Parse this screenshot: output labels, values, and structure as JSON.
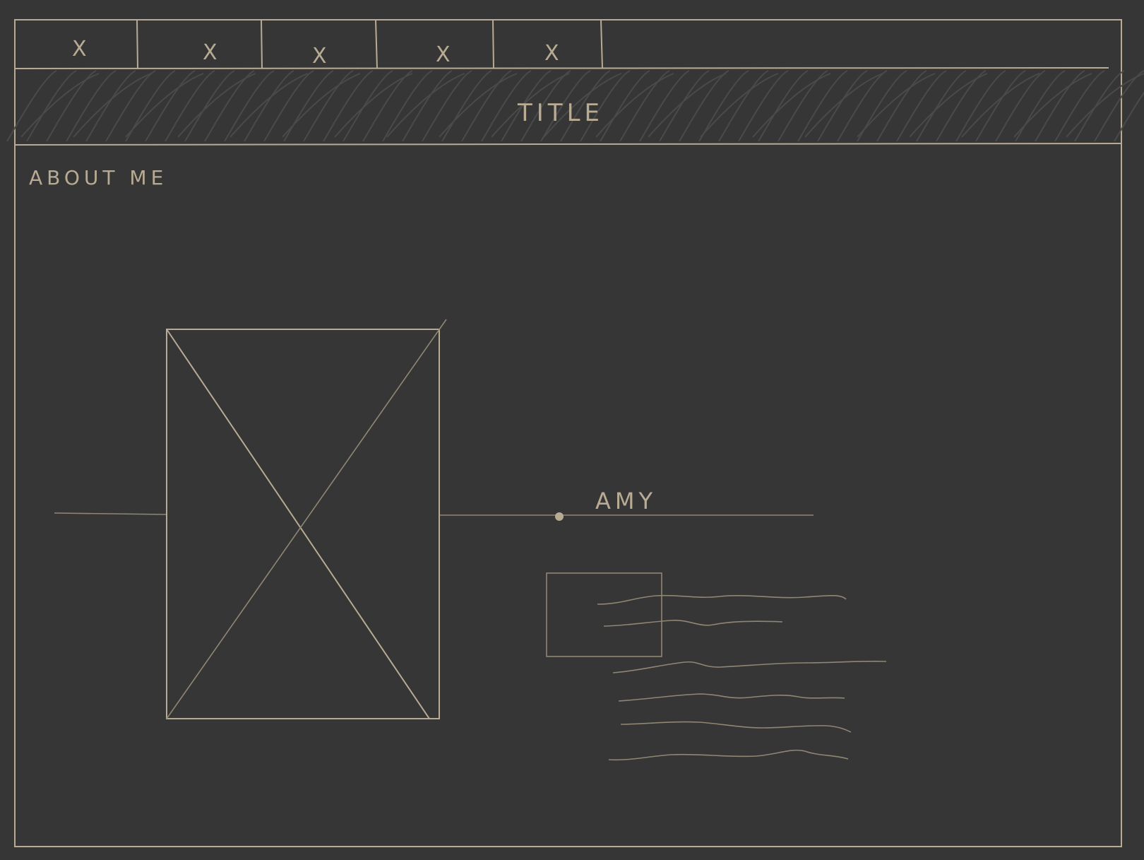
{
  "tabs": [
    {
      "label": "X"
    },
    {
      "label": "X"
    },
    {
      "label": "X"
    },
    {
      "label": "X"
    },
    {
      "label": "X"
    }
  ],
  "header": {
    "title": "TITLE"
  },
  "section": {
    "heading": "ABOUT ME"
  },
  "profile": {
    "name": "AMY",
    "image_placeholder": "image-placeholder"
  },
  "text_block": {
    "line_count": 6
  },
  "colors": {
    "background": "#363636",
    "ink": "#b8ab93",
    "ink_light": "#8f8674",
    "hatch": "#4a4a4a"
  }
}
